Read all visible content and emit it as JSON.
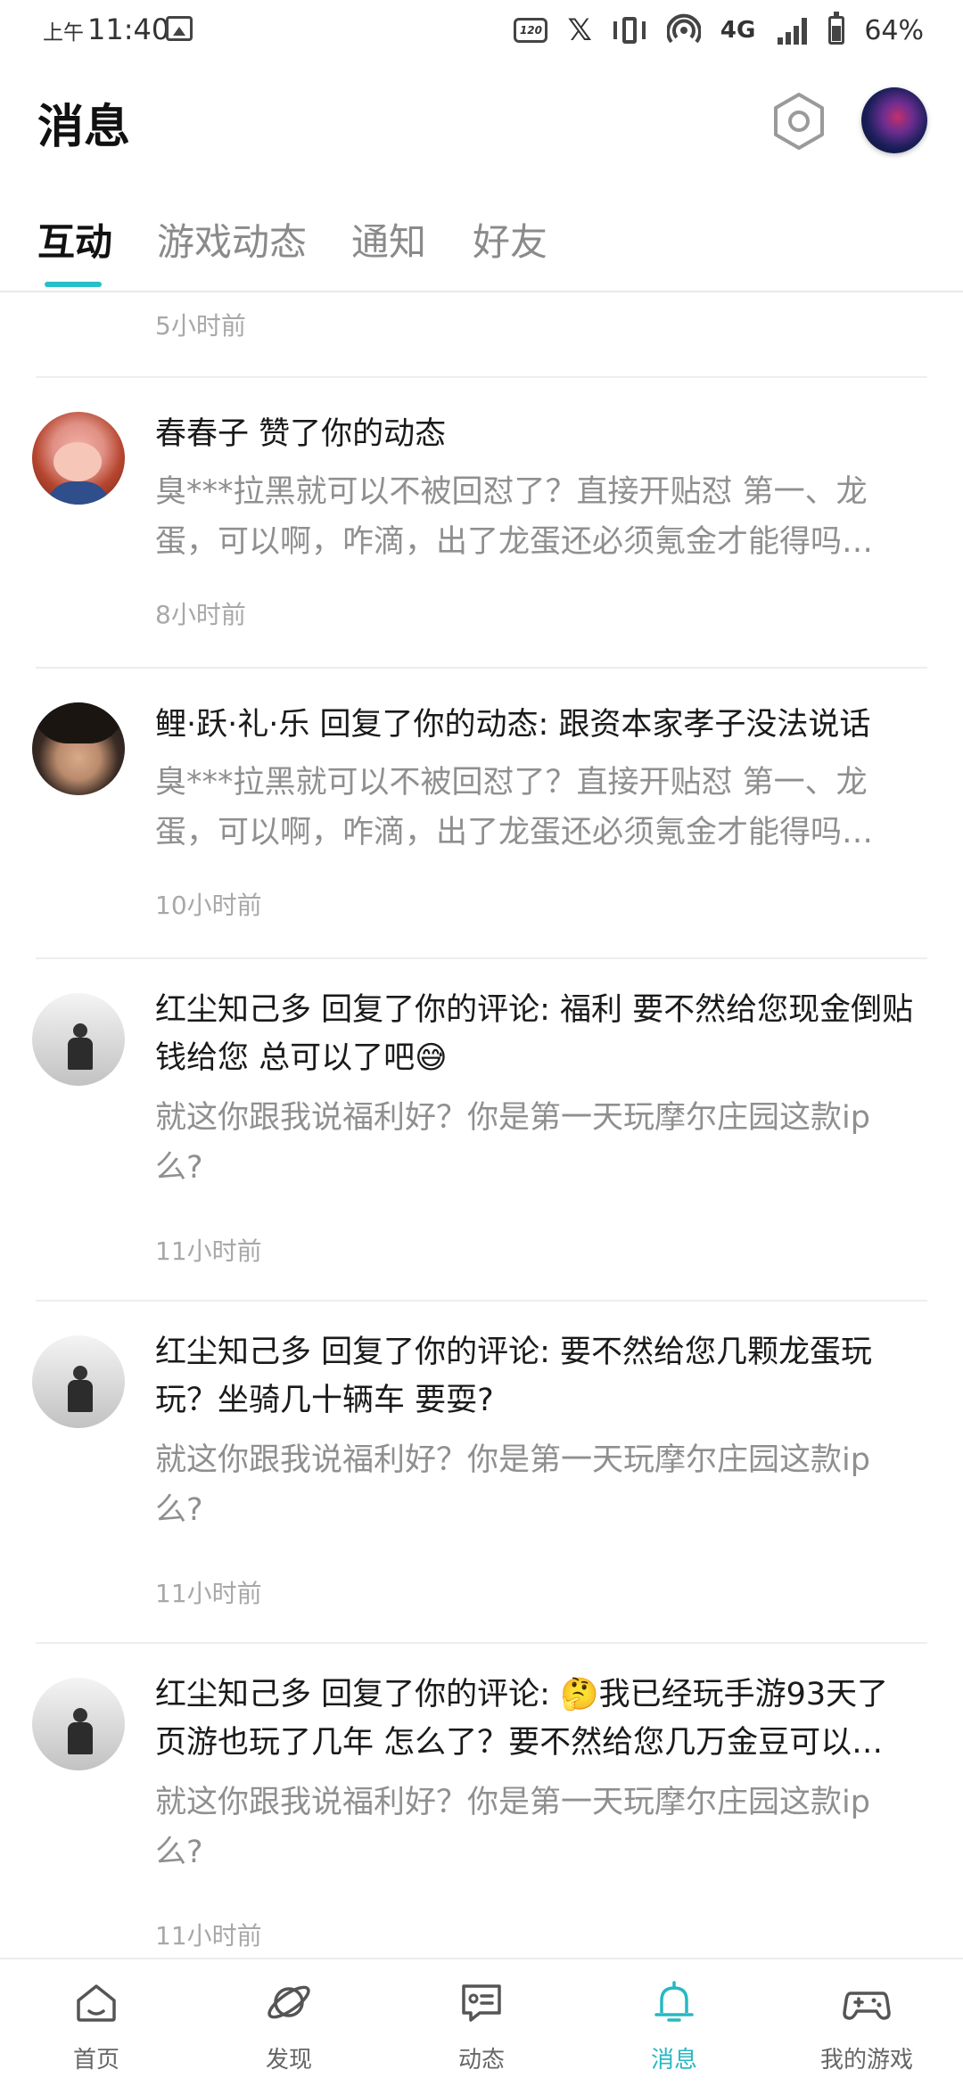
{
  "status_bar": {
    "ampm": "上午",
    "time": "11:40",
    "refresh_rate": "120Hz",
    "network": "4G",
    "battery": "64%",
    "battery_level": 0.64
  },
  "header": {
    "title": "消息"
  },
  "tabs": [
    {
      "label": "互动",
      "active": true
    },
    {
      "label": "游戏动态",
      "active": false
    },
    {
      "label": "通知",
      "active": false
    },
    {
      "label": "好友",
      "active": false
    }
  ],
  "notifications": [
    {
      "title": "",
      "body": "",
      "time": "5小时前"
    },
    {
      "avatar": "girl",
      "title": "春春子 赞了你的动态",
      "body": "臭***拉黑就可以不被回怼了？直接开贴怼 第一、龙蛋，可以啊，咋滴，出了龙蛋还必须氪金才能得吗…",
      "time": "8小时前"
    },
    {
      "avatar": "anime",
      "title": "鲤·跃·礼·乐 回复了你的动态: 跟资本家孝子没法说话",
      "body": "臭***拉黑就可以不被回怼了？直接开贴怼 第一、龙蛋，可以啊，咋滴，出了龙蛋还必须氪金才能得吗…",
      "time": "10小时前"
    },
    {
      "avatar": "bw",
      "title": "红尘知己多 回复了你的评论: 福利 要不然给您现金倒贴钱给您 总可以了吧😅",
      "body": "就这你跟我说福利好？你是第一天玩摩尔庄园这款ip么?",
      "time": "11小时前"
    },
    {
      "avatar": "bw",
      "title": "红尘知己多 回复了你的评论: 要不然给您几颗龙蛋玩玩？坐骑几十辆车 要耍?",
      "body": "就这你跟我说福利好？你是第一天玩摩尔庄园这款ip么?",
      "time": "11小时前"
    },
    {
      "avatar": "bw",
      "title": "红尘知己多 回复了你的评论: 🤔我已经玩手游93天了 页游也玩了几年 怎么了？要不然给您几万金豆可以…",
      "body": "就这你跟我说福利好？你是第一天玩摩尔庄园这款ip么?",
      "time": "11小时前"
    }
  ],
  "bottom_nav": [
    {
      "label": "首页",
      "icon": "home-icon",
      "active": false
    },
    {
      "label": "发现",
      "icon": "planet-icon",
      "active": false
    },
    {
      "label": "动态",
      "icon": "feed-icon",
      "active": false
    },
    {
      "label": "消息",
      "icon": "bell-icon",
      "active": true
    },
    {
      "label": "我的游戏",
      "icon": "gamepad-icon",
      "active": false
    }
  ],
  "colors": {
    "accent": "#27c0c8",
    "text_primary": "#1a1a1a",
    "text_secondary": "#8f8f8f"
  }
}
